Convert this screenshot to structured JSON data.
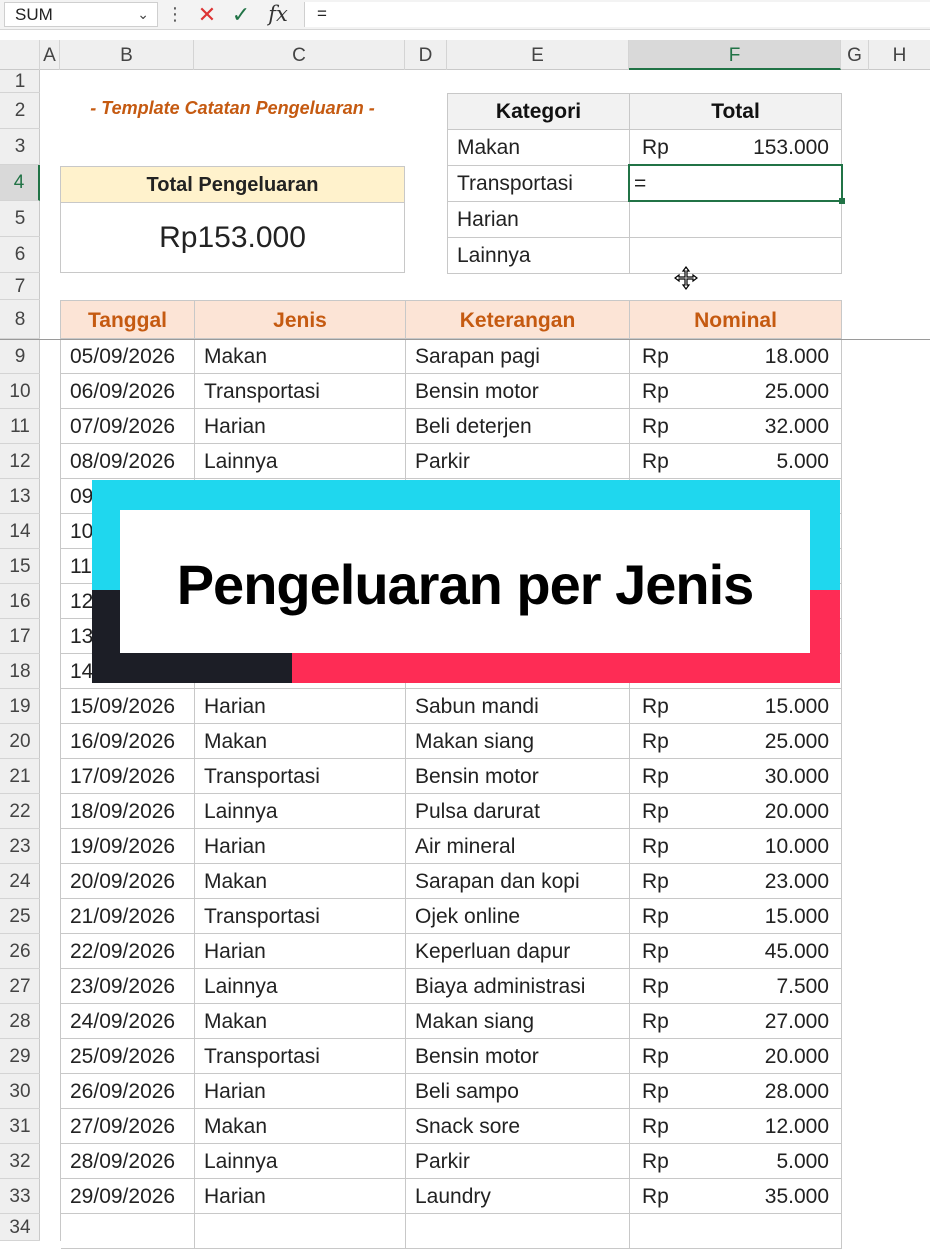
{
  "formula_bar": {
    "name_box": "SUM",
    "chevron": "⌄",
    "more": "⋮",
    "cancel_icon": "✕",
    "enter_icon": "✓",
    "fx_label": "fx",
    "formula": "="
  },
  "columns": [
    "A",
    "B",
    "C",
    "D",
    "E",
    "F",
    "G",
    "H"
  ],
  "selected_column": "F",
  "rows": [
    "1",
    "2",
    "3",
    "4",
    "5",
    "6",
    "7",
    "8",
    "9",
    "10",
    "11",
    "12",
    "13",
    "14",
    "15",
    "16",
    "17",
    "18",
    "19",
    "20",
    "21",
    "22",
    "23",
    "24",
    "25",
    "26",
    "27",
    "28",
    "29",
    "30",
    "31",
    "32",
    "33",
    "34"
  ],
  "selected_row": "4",
  "template_title": "- Template Catatan Pengeluaran -",
  "total_box": {
    "label": "Total Pengeluaran",
    "value": "Rp153.000"
  },
  "category_table": {
    "headers": [
      "Kategori",
      "Total"
    ],
    "rows": [
      {
        "kategori": "Makan",
        "currency": "Rp",
        "total": "153.000"
      },
      {
        "kategori": "Transportasi",
        "currency": "",
        "total": "="
      },
      {
        "kategori": "Harian",
        "currency": "",
        "total": ""
      },
      {
        "kategori": "Lainnya",
        "currency": "",
        "total": ""
      }
    ]
  },
  "expense_table": {
    "headers": [
      "Tanggal",
      "Jenis",
      "Keterangan",
      "Nominal"
    ],
    "rows": [
      {
        "tanggal": "05/09/2026",
        "jenis": "Makan",
        "keterangan": "Sarapan pagi",
        "rp": "Rp",
        "nominal": "18.000"
      },
      {
        "tanggal": "06/09/2026",
        "jenis": "Transportasi",
        "keterangan": "Bensin motor",
        "rp": "Rp",
        "nominal": "25.000"
      },
      {
        "tanggal": "07/09/2026",
        "jenis": "Harian",
        "keterangan": "Beli deterjen",
        "rp": "Rp",
        "nominal": "32.000"
      },
      {
        "tanggal": "08/09/2026",
        "jenis": "Lainnya",
        "keterangan": "Parkir",
        "rp": "Rp",
        "nominal": "5.000"
      },
      {
        "tanggal": "09",
        "jenis": "",
        "keterangan": "",
        "rp": "",
        "nominal": ""
      },
      {
        "tanggal": "10",
        "jenis": "",
        "keterangan": "",
        "rp": "",
        "nominal": ""
      },
      {
        "tanggal": "11",
        "jenis": "",
        "keterangan": "",
        "rp": "",
        "nominal": ""
      },
      {
        "tanggal": "12",
        "jenis": "",
        "keterangan": "",
        "rp": "",
        "nominal": ""
      },
      {
        "tanggal": "13",
        "jenis": "",
        "keterangan": "",
        "rp": "",
        "nominal": ""
      },
      {
        "tanggal": "14",
        "jenis": "",
        "keterangan": "",
        "rp": "",
        "nominal": ""
      },
      {
        "tanggal": "15/09/2026",
        "jenis": "Harian",
        "keterangan": "Sabun mandi",
        "rp": "Rp",
        "nominal": "15.000"
      },
      {
        "tanggal": "16/09/2026",
        "jenis": "Makan",
        "keterangan": "Makan siang",
        "rp": "Rp",
        "nominal": "25.000"
      },
      {
        "tanggal": "17/09/2026",
        "jenis": "Transportasi",
        "keterangan": "Bensin motor",
        "rp": "Rp",
        "nominal": "30.000"
      },
      {
        "tanggal": "18/09/2026",
        "jenis": "Lainnya",
        "keterangan": "Pulsa darurat",
        "rp": "Rp",
        "nominal": "20.000"
      },
      {
        "tanggal": "19/09/2026",
        "jenis": "Harian",
        "keterangan": "Air mineral",
        "rp": "Rp",
        "nominal": "10.000"
      },
      {
        "tanggal": "20/09/2026",
        "jenis": "Makan",
        "keterangan": "Sarapan dan kopi",
        "rp": "Rp",
        "nominal": "23.000"
      },
      {
        "tanggal": "21/09/2026",
        "jenis": "Transportasi",
        "keterangan": "Ojek online",
        "rp": "Rp",
        "nominal": "15.000"
      },
      {
        "tanggal": "22/09/2026",
        "jenis": "Harian",
        "keterangan": "Keperluan dapur",
        "rp": "Rp",
        "nominal": "45.000"
      },
      {
        "tanggal": "23/09/2026",
        "jenis": "Lainnya",
        "keterangan": "Biaya administrasi",
        "rp": "Rp",
        "nominal": "7.500"
      },
      {
        "tanggal": "24/09/2026",
        "jenis": "Makan",
        "keterangan": "Makan siang",
        "rp": "Rp",
        "nominal": "27.000"
      },
      {
        "tanggal": "25/09/2026",
        "jenis": "Transportasi",
        "keterangan": "Bensin motor",
        "rp": "Rp",
        "nominal": "20.000"
      },
      {
        "tanggal": "26/09/2026",
        "jenis": "Harian",
        "keterangan": "Beli sampo",
        "rp": "Rp",
        "nominal": "28.000"
      },
      {
        "tanggal": "27/09/2026",
        "jenis": "Makan",
        "keterangan": "Snack sore",
        "rp": "Rp",
        "nominal": "12.000"
      },
      {
        "tanggal": "28/09/2026",
        "jenis": "Lainnya",
        "keterangan": "Parkir",
        "rp": "Rp",
        "nominal": "5.000"
      },
      {
        "tanggal": "29/09/2026",
        "jenis": "Harian",
        "keterangan": "Laundry",
        "rp": "Rp",
        "nominal": "35.000"
      },
      {
        "tanggal": "",
        "jenis": "",
        "keterangan": "",
        "rp": "",
        "nominal": ""
      }
    ]
  },
  "overlay_banner": {
    "text": "Pengeluaran per Jenis"
  },
  "cursor_icon": "move-cursor-icon"
}
